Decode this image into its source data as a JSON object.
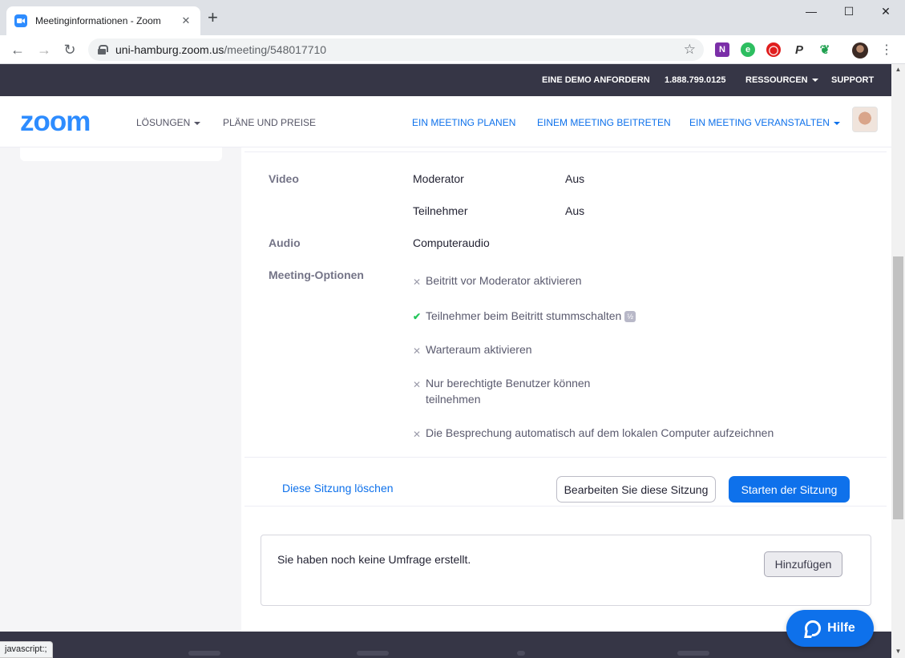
{
  "browser": {
    "tab_title": "Meetinginformationen - Zoom",
    "tab_close": "✕",
    "new_tab": "+",
    "url_host": "uni-hamburg.zoom.us",
    "url_path": "/meeting/548017710",
    "back": "←",
    "forward": "→",
    "reload": "↻",
    "star": "☆",
    "minimize": "—",
    "maximize": "☐",
    "close": "✕",
    "menu": "⋮",
    "extensions": [
      "onenote-icon",
      "evernote-icon",
      "adblock-icon",
      "paypal-icon",
      "leaf-icon"
    ],
    "status_url": "javascript:;"
  },
  "topbar": {
    "demo": "EINE DEMO ANFORDERN",
    "phone": "1.888.799.0125",
    "resources": "RESSOURCEN",
    "support": "SUPPORT"
  },
  "nav": {
    "logo": "zoom",
    "solutions": "LÖSUNGEN",
    "plans": "PLÄNE UND PREISE",
    "schedule": "EIN MEETING PLANEN",
    "join": "EINEM MEETING BEITRETEN",
    "host": "EIN MEETING VERANSTALTEN"
  },
  "meeting": {
    "video_label": "Video",
    "host_label": "Moderator",
    "host_value": "Aus",
    "participant_label": "Teilnehmer",
    "participant_value": "Aus",
    "audio_label": "Audio",
    "audio_value": "Computeraudio",
    "options_label": "Meeting-Optionen",
    "options": [
      {
        "text": "Beitritt vor Moderator aktivieren",
        "enabled": false
      },
      {
        "text": "Teilnehmer beim Beitritt stummschalten",
        "enabled": true
      },
      {
        "text": "Warteraum aktivieren",
        "enabled": false
      },
      {
        "text": "Nur berechtigte Benutzer können",
        "text2": "teilnehmen",
        "enabled": false
      },
      {
        "text": "Die Besprechung automatisch auf dem lokalen Computer aufzeichnen",
        "enabled": false
      }
    ],
    "enabled_icon": "✔",
    "disabled_icon": "✕",
    "info_badge": "½",
    "delete": "Diese Sitzung löschen",
    "edit": "Bearbeiten Sie diese Sitzung",
    "start": "Starten der Sitzung"
  },
  "poll": {
    "empty_text": "Sie haben noch keine Umfrage erstellt.",
    "add": "Hinzufügen"
  },
  "help": {
    "label": "Hilfe"
  },
  "colors": {
    "accent": "#0e71eb",
    "topbar": "#363646",
    "check": "#23c55a"
  }
}
